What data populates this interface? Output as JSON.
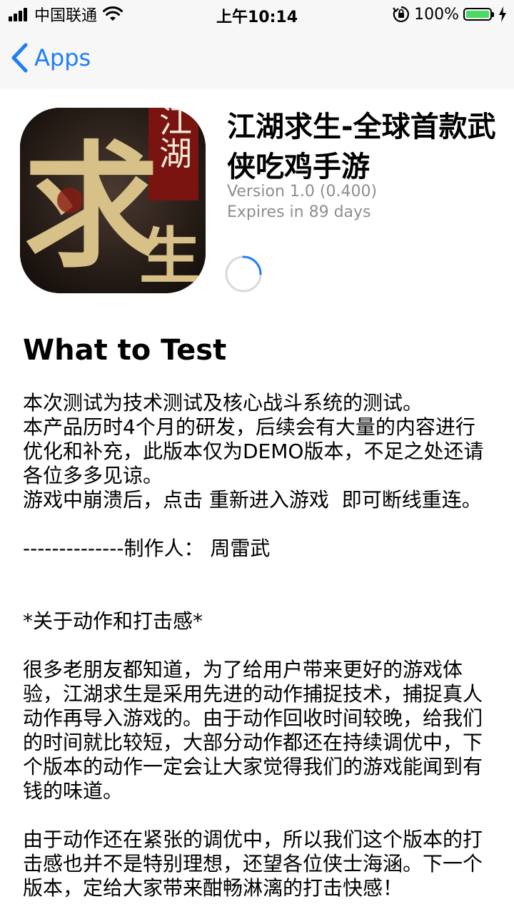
{
  "status_bar": {
    "carrier": "中国联通",
    "time": "上午10:14",
    "battery": "100%",
    "battery_level": 1.0
  },
  "nav": {
    "back_label": "Apps"
  },
  "app": {
    "icon_text_1": "江湖",
    "icon_text_2": "求",
    "icon_text_3": "生",
    "title": "江湖求生-全球首款武侠吃鸡手游",
    "version": "Version 1.0 (0.400)",
    "expires": "Expires in 89 days"
  },
  "what_to_test": {
    "heading": "What to Test",
    "p1": "本次测试为技术测试及核心战斗系统的测试。",
    "p2": "本产品历时4个月的研发，后续会有大量的内容进行优化和补充，此版本仅为DEMO版本，不足之处还请各位多多见谅。",
    "p3": "游戏中崩溃后，点击 重新进入游戏  即可断线重连。",
    "p4": "--------------制作人： 周雷武",
    "p5": "*关于动作和打击感*",
    "p6": "很多老朋友都知道，为了给用户带来更好的游戏体验，江湖求生是采用先进的动作捕捉技术，捕捉真人动作再导入游戏的。由于动作回收时间较晚，给我们的时间就比较短，大部分动作都还在持续调优中，下个版本的动作一定会让大家觉得我们的游戏能闻到有钱的味道。",
    "p7": "由于动作还在紧张的调优中，所以我们这个版本的打击感也并不是特别理想，还望各位侠士海涵。下一个版本，定给大家带来酣畅淋漓的打击快感！"
  },
  "colors": {
    "accent": "#1f7ef7",
    "secondary_text": "#8e8e93",
    "battery_green": "#4cd964"
  }
}
